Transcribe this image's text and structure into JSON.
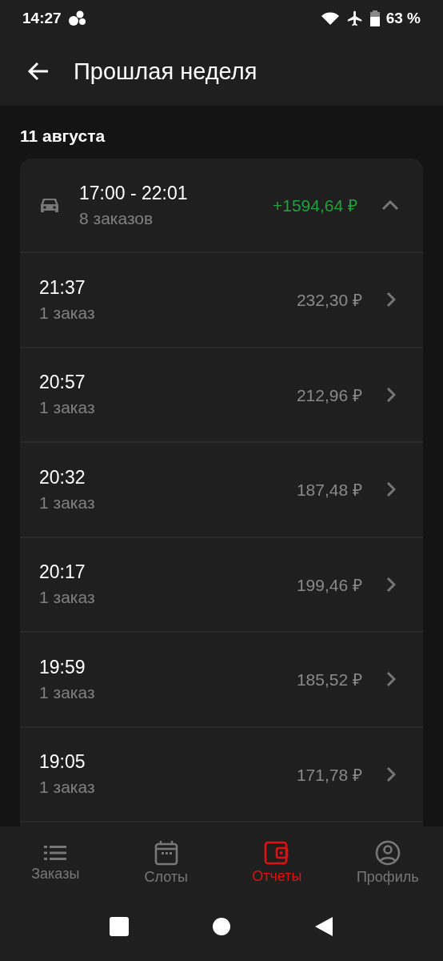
{
  "status_bar": {
    "time": "14:27",
    "battery": "63 %"
  },
  "app_bar": {
    "title": "Прошлая неделя"
  },
  "date": "11 августа",
  "shift": {
    "time": "17:00 - 22:01",
    "orders": "8 заказов",
    "amount": "+1594,64 ₽",
    "expanded": true,
    "items": [
      {
        "time": "21:37",
        "orders": "1 заказ",
        "amount": "232,30 ₽"
      },
      {
        "time": "20:57",
        "orders": "1 заказ",
        "amount": "212,96 ₽"
      },
      {
        "time": "20:32",
        "orders": "1 заказ",
        "amount": "187,48 ₽"
      },
      {
        "time": "20:17",
        "orders": "1 заказ",
        "amount": "199,46 ₽"
      },
      {
        "time": "19:59",
        "orders": "1 заказ",
        "amount": "185,52 ₽"
      },
      {
        "time": "19:05",
        "orders": "1 заказ",
        "amount": "171,78 ₽"
      }
    ]
  },
  "nav": [
    {
      "label": "Заказы",
      "kind": "list",
      "selected": false
    },
    {
      "label": "Слоты",
      "kind": "calendar",
      "selected": false
    },
    {
      "label": "Отчеты",
      "kind": "wallet",
      "selected": true
    },
    {
      "label": "Профиль",
      "kind": "profile",
      "selected": false
    }
  ]
}
